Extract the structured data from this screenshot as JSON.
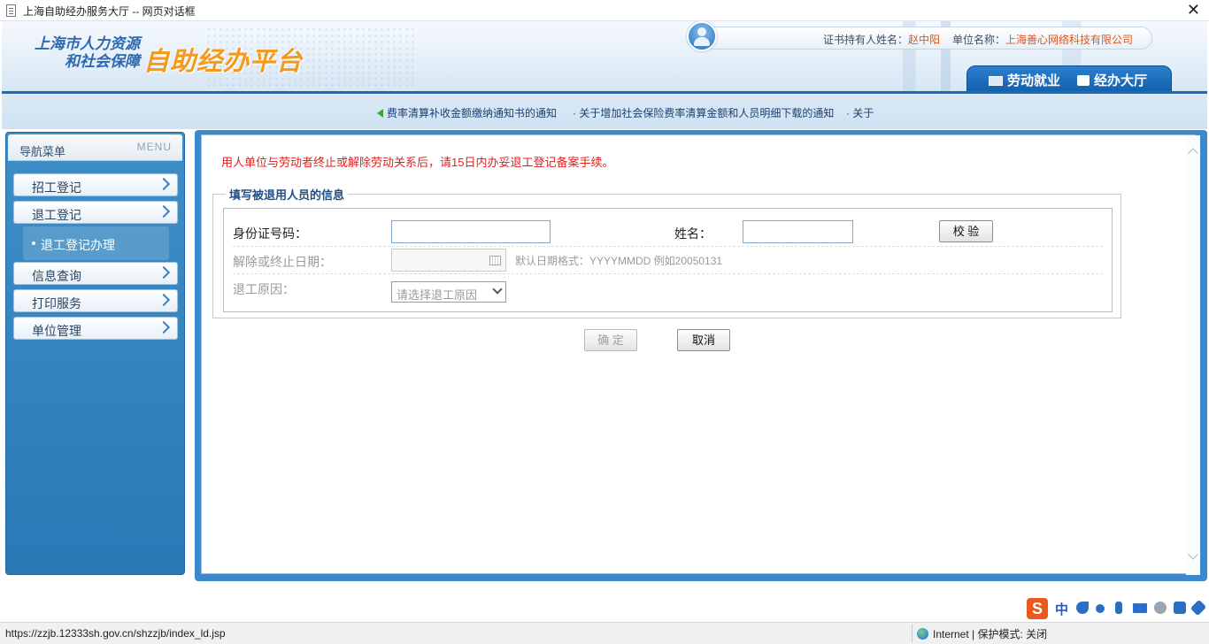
{
  "window": {
    "title": "上海自助经办服务大厅 -- 网页对话框",
    "close_glyph": "✕"
  },
  "header": {
    "org_line1": "上海市人力资源",
    "org_line2": "和社会保障",
    "platform": "自助经办平台",
    "cert_holder_label": "证书持有人姓名：",
    "cert_holder_name": "赵中阳",
    "unit_label": "单位名称：",
    "unit_name": "上海善心网络科技有限公司",
    "tabs": [
      {
        "label": "劳动就业"
      },
      {
        "label": "经办大厅"
      }
    ]
  },
  "notices": [
    "费率清算补收金额缴纳通知书的通知",
    "· 关于增加社会保险费率清算金额和人员明细下载的通知",
    "· 关于"
  ],
  "sidebar": {
    "title": "导航菜单",
    "menu_tag": "MENU",
    "items": [
      {
        "label": "招工登记"
      },
      {
        "label": "退工登记"
      },
      {
        "label": "信息查询"
      },
      {
        "label": "打印服务"
      },
      {
        "label": "单位管理"
      }
    ],
    "sub_items": [
      {
        "label": "退工登记办理"
      }
    ]
  },
  "main": {
    "alert": "用人单位与劳动者终止或解除劳动关系后，请15日内办妥退工登记备案手续。",
    "legend": "填写被退用人员的信息",
    "id_label": "身份证号码：",
    "id_value": "",
    "name_label": "姓名：",
    "name_value": "",
    "verify_button": "校 验",
    "date_label": "解除或终止日期：",
    "date_value": "",
    "date_hint": "默认日期格式：YYYYMMDD 例如20050131",
    "reason_label": "退工原因：",
    "reason_placeholder": "请选择退工原因",
    "confirm_button": "确 定",
    "cancel_button": "取消"
  },
  "ime": {
    "logo": "S",
    "mode": "中"
  },
  "status": {
    "url": "https://zzjb.12333sh.gov.cn/shzzjb/index_ld.jsp",
    "zone": "Internet | 保护模式: 关闭"
  }
}
